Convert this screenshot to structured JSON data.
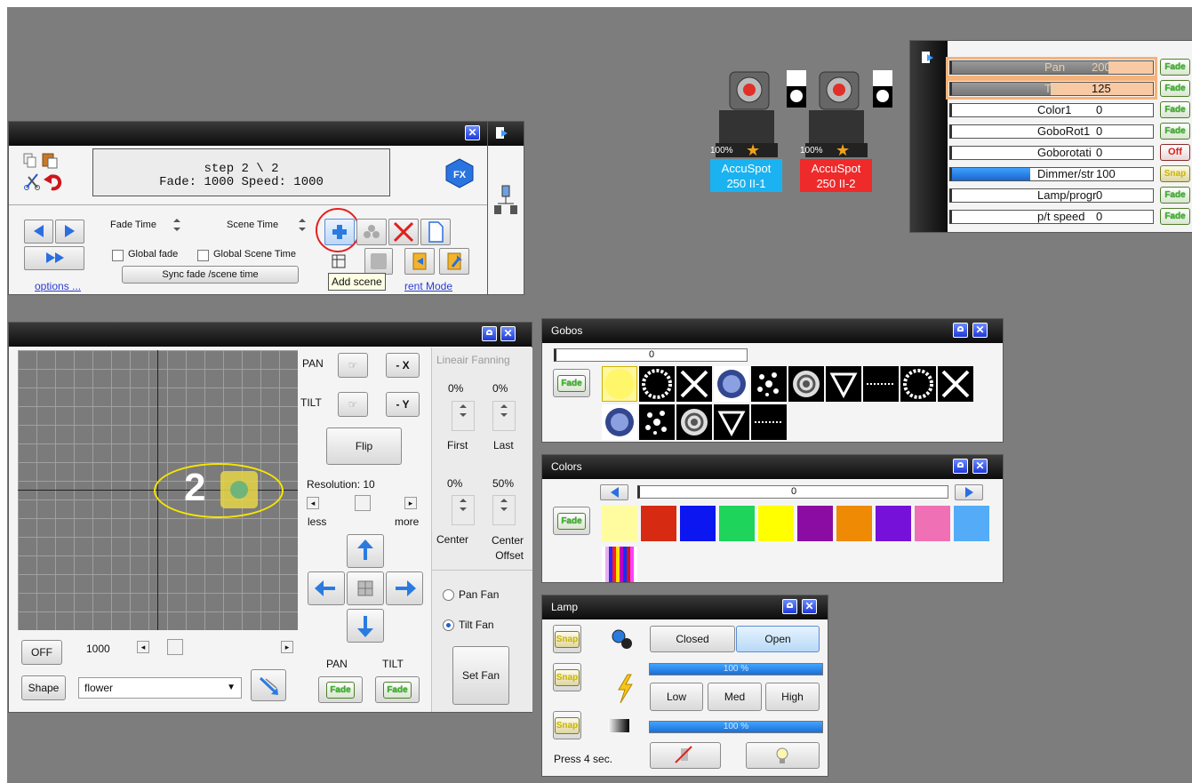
{
  "scene_panel": {
    "display_line1": "step 2 \\ 2",
    "display_line2": "Fade: 1000  Speed: 1000",
    "fx_label": "FX",
    "fade_time_label": "Fade Time",
    "scene_time_label": "Scene Time",
    "global_fade_label": "Global fade",
    "global_scene_time_label": "Global Scene Time",
    "sync_label": "Sync fade /scene time",
    "options_link": "options ...",
    "mode_link_partial": "rent Mode",
    "tooltip": "Add scene"
  },
  "fixtures": [
    {
      "name_line1": "AccuSpot",
      "name_line2": "250 II-1",
      "level": "100%",
      "color": "#1ab2f0"
    },
    {
      "name_line1": "AccuSpot",
      "name_line2": "250 II-2",
      "level": "100%",
      "color": "#ef2a2a"
    }
  ],
  "channels": {
    "rows": [
      {
        "name": "Pan",
        "value": "200",
        "fill": 0.78,
        "btn": "Fade"
      },
      {
        "name": "Tilt",
        "value": "125",
        "fill": 0.49,
        "btn": "Fade"
      },
      {
        "name": "Color1",
        "value": "0",
        "fill": 0,
        "btn": "Fade"
      },
      {
        "name": "GoboRot1",
        "value": "0",
        "fill": 0,
        "btn": "Fade"
      },
      {
        "name": "Goborotati",
        "value": "0",
        "fill": 0,
        "btn": "Off"
      },
      {
        "name": "Dimmer/str",
        "value": "100",
        "fill": 0.39,
        "btn": "Snap"
      },
      {
        "name": "Lamp/progr",
        "value": "0",
        "fill": 0,
        "btn": "Fade"
      },
      {
        "name": "p/t speed",
        "value": "0",
        "fill": 0,
        "btn": "Fade"
      }
    ]
  },
  "pantilt": {
    "pan_label": "PAN",
    "tilt_label": "TILT",
    "minus_x": "- X",
    "minus_y": "- Y",
    "flip": "Flip",
    "resolution": "Resolution: 10",
    "less": "less",
    "more": "more",
    "step_marker": "2",
    "off": "OFF",
    "speed_value": "1000",
    "shape": "Shape",
    "shape_value": "flower",
    "pan_btn_label": "PAN",
    "tilt_btn_label": "TILT",
    "fade": "Fade",
    "fanning_title": "Lineair Fanning",
    "first_pct": "0%",
    "last_pct": "0%",
    "first": "First",
    "last": "Last",
    "center_pct": "0%",
    "offset_pct": "50%",
    "center": "Center",
    "center_offset": "Center Offset",
    "pan_fan": "Pan Fan",
    "tilt_fan": "Tilt Fan",
    "set_fan": "Set Fan"
  },
  "gobos": {
    "title": "Gobos",
    "slider_value": "0",
    "fade": "Fade"
  },
  "colors": {
    "title": "Colors",
    "slider_value": "0",
    "fade": "Fade",
    "swatches": [
      "#fffca0",
      "#d62a12",
      "#0b16f0",
      "#1ed45a",
      "#ffff00",
      "#8a0ca3",
      "#ef8a05",
      "#7511d8",
      "#ef70b5",
      "#54abf7"
    ]
  },
  "lamp": {
    "title": "Lamp",
    "snap": "Snap",
    "closed": "Closed",
    "open": "Open",
    "bar1": "100 %",
    "low": "Low",
    "med": "Med",
    "high": "High",
    "bar2": "100 %",
    "press": "Press 4 sec."
  }
}
